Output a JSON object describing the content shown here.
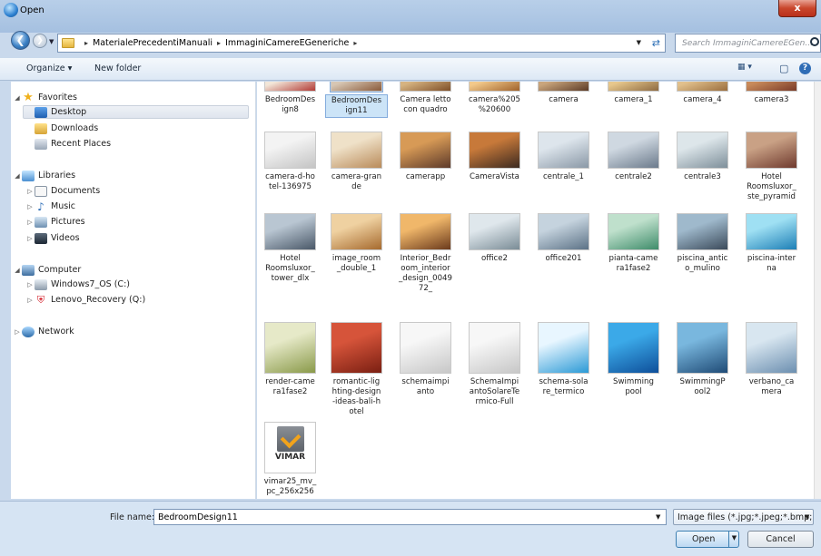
{
  "window": {
    "title": "Open",
    "close_label": "x"
  },
  "address": {
    "crumbs": [
      "MaterialePrecedentiManuali",
      "ImmaginiCamereEGeneriche"
    ],
    "separator": "▸",
    "refresh_icon": "refresh-icon"
  },
  "search": {
    "placeholder": "Search ImmaginiCamereEGen..."
  },
  "toolbar": {
    "organize_label": "Organize ▾",
    "new_folder_label": "New folder",
    "view_icon": "▦ ▾",
    "preview_icon": "▢",
    "help_icon": "?"
  },
  "sidebar": {
    "items": [
      {
        "label": "Favorites",
        "icon": "star-icon"
      },
      {
        "label": "Desktop",
        "icon": "desktop-icon",
        "selected": true
      },
      {
        "label": "Downloads",
        "icon": "downloads-icon"
      },
      {
        "label": "Recent Places",
        "icon": "recent-places-icon"
      },
      {
        "label": "Libraries",
        "icon": "libraries-icon"
      },
      {
        "label": "Documents",
        "icon": "documents-icon"
      },
      {
        "label": "Music",
        "icon": "music-icon"
      },
      {
        "label": "Pictures",
        "icon": "pictures-icon"
      },
      {
        "label": "Videos",
        "icon": "videos-icon"
      },
      {
        "label": "Computer",
        "icon": "computer-icon"
      },
      {
        "label": "Windows7_OS (C:)",
        "icon": "drive-icon"
      },
      {
        "label": "Lenovo_Recovery (Q:)",
        "icon": "recovery-drive-icon"
      },
      {
        "label": "Network",
        "icon": "network-icon"
      }
    ]
  },
  "files": [
    {
      "name": "BedroomDesign8"
    },
    {
      "name": "BedroomDesign11",
      "selected": true
    },
    {
      "name": "Camera letto con quadro"
    },
    {
      "name": "camera%205%20600"
    },
    {
      "name": "camera"
    },
    {
      "name": "camera_1"
    },
    {
      "name": "camera_4"
    },
    {
      "name": "camera3"
    },
    {
      "name": "camera-d-hotel-136975"
    },
    {
      "name": "camera-grande"
    },
    {
      "name": "camerapp"
    },
    {
      "name": "CameraVista"
    },
    {
      "name": "centrale_1"
    },
    {
      "name": "centrale2"
    },
    {
      "name": "centrale3"
    },
    {
      "name": "Hotel Roomsluxor_ste_pyramid"
    },
    {
      "name": "Hotel Roomsluxor_tower_dlx"
    },
    {
      "name": "image_room_double_1"
    },
    {
      "name": "Interior_Bedroom_interior_design_004972_"
    },
    {
      "name": "office2"
    },
    {
      "name": "office201"
    },
    {
      "name": "pianta-camera1fase2"
    },
    {
      "name": "piscina_antico_mulino"
    },
    {
      "name": "piscina-interna"
    },
    {
      "name": "render-camera1fase2"
    },
    {
      "name": "romantic-lighting-design-ideas-bali-hotel"
    },
    {
      "name": "schemaimpianto"
    },
    {
      "name": "SchemaImpiantoSolareTermico-Full"
    },
    {
      "name": "schema-solare_termico"
    },
    {
      "name": "Swimming pool"
    },
    {
      "name": "SwimmingPool2"
    },
    {
      "name": "verbano_camera"
    },
    {
      "name": "vimar25_mv_pc_256x256"
    }
  ],
  "file_labels": [
    "BedroomDes\nign8",
    "BedroomDes\nign11",
    "Camera letto\ncon quadro",
    "camera%205\n%20600",
    "camera",
    "camera_1",
    "camera_4",
    "camera3",
    "camera-d-ho\ntel-136975",
    "camera-gran\nde",
    "camerapp",
    "CameraVista",
    "centrale_1",
    "centrale2",
    "centrale3",
    "Hotel\nRoomsluxor_\nste_pyramid",
    "Hotel\nRoomsluxor_\ntower_dlx",
    "image_room\n_double_1",
    "Interior_Bedr\noom_interior\n_design_0049\n72_",
    "office2",
    "office201",
    "pianta-came\nra1fase2",
    "piscina_antic\no_mulino",
    "piscina-inter\nna",
    "render-came\nra1fase2",
    "romantic-lig\nhting-design\n-ideas-bali-h\notel",
    "schemaimpi\nanto",
    "SchemaImpi\nantoSolareTe\nrmico-Full",
    "schema-sola\nre_termico",
    "Swimming\npool",
    "SwimmingP\nool2",
    "verbano_ca\nmera",
    "vimar25_mv_\npc_256x256"
  ],
  "vimar_logo_text": "VIMAR",
  "bottom": {
    "filename_label": "File name:",
    "filename_value": "BedroomDesign11",
    "filter_value": "Image files (*.jpg;*.jpeg;*.bmp;",
    "open_label": "Open",
    "cancel_label": "Cancel"
  },
  "colors": {
    "selection": "#cce4f7",
    "title_bar": "#b8cfe9",
    "close_button": "#c9462c"
  }
}
